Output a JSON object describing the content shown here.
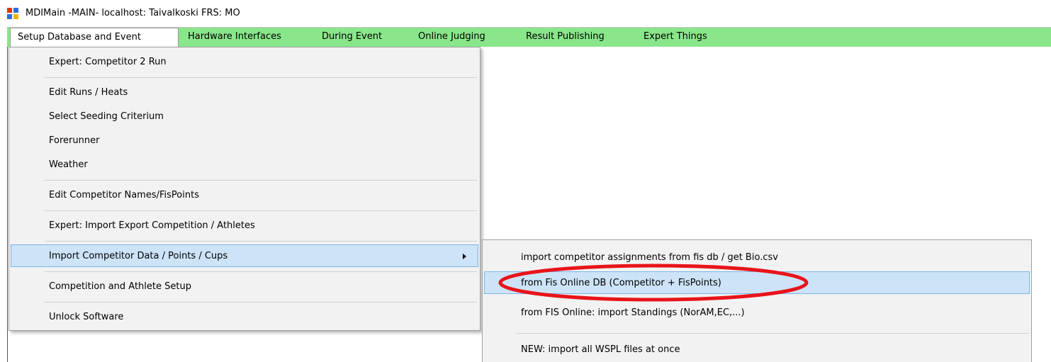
{
  "window": {
    "title": "MDIMain -MAIN- localhost: Taivalkoski FRS: MO"
  },
  "menubar": {
    "background": "#8ae68a",
    "items": [
      {
        "label": "Setup Database and Event"
      },
      {
        "label": "Hardware Interfaces"
      },
      {
        "label": "During Event"
      },
      {
        "label": "Online Judging"
      },
      {
        "label": "Result Publishing"
      },
      {
        "label": "Expert Things"
      }
    ]
  },
  "dropdown": {
    "items": [
      {
        "label": "Expert: Competitor 2 Run"
      },
      {
        "label": "Edit Runs / Heats"
      },
      {
        "label": "Select Seeding Criterium"
      },
      {
        "label": "Forerunner"
      },
      {
        "label": "Weather"
      },
      {
        "label": "Edit Competitor Names/FisPoints"
      },
      {
        "label": "Expert: Import Export Competition / Athletes"
      },
      {
        "label": "Import Competitor Data / Points / Cups"
      },
      {
        "label": "Competition and Athlete Setup"
      },
      {
        "label": "Unlock Software"
      }
    ]
  },
  "submenu": {
    "items": [
      {
        "label": "import competitor assignments from fis db / get Bio.csv"
      },
      {
        "label": "from Fis Online DB (Competitor + FisPoints)"
      },
      {
        "label": "from FIS Online: import Standings (NorAM,EC,...)"
      },
      {
        "label": "NEW: import all WSPL files at once"
      }
    ]
  },
  "colors": {
    "highlight": "#cde3f7",
    "highlight_border": "#7eb4ea",
    "annotation": "#e8141a"
  }
}
